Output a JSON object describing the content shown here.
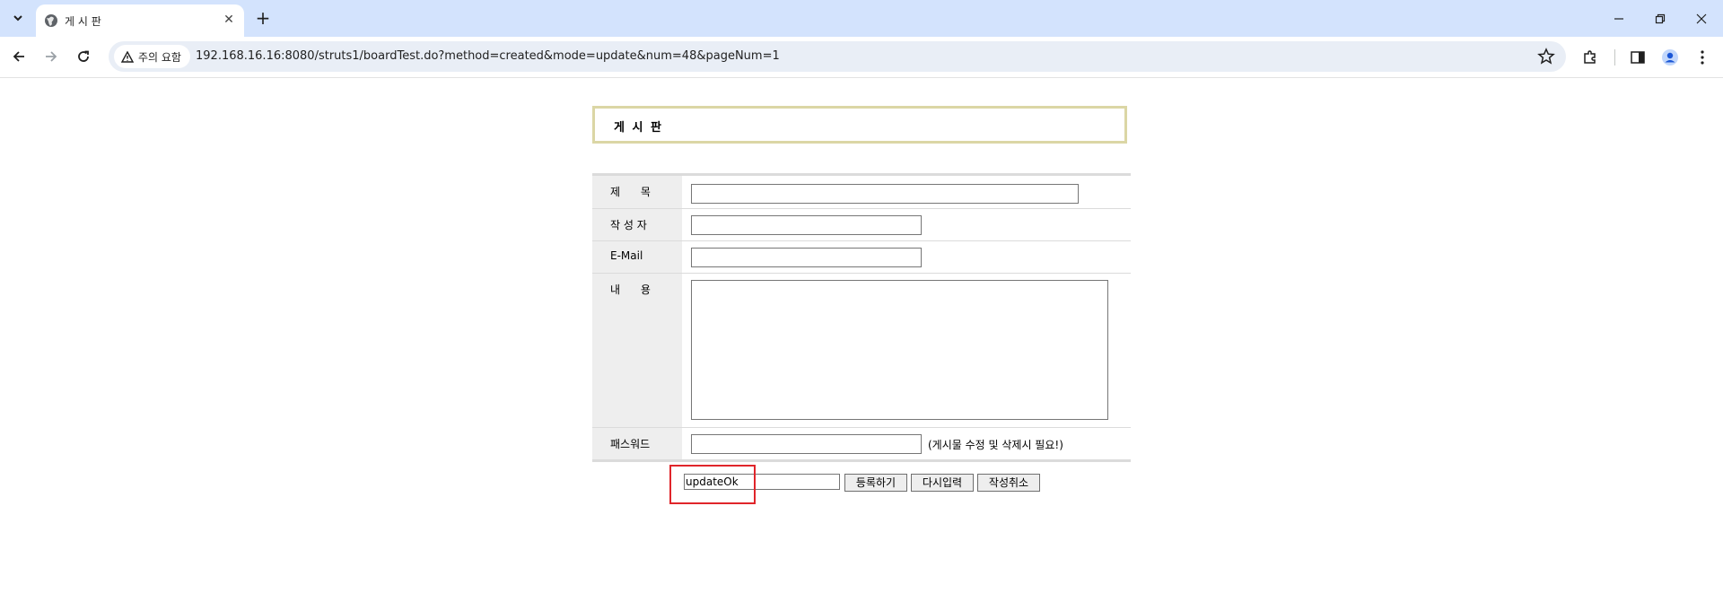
{
  "browser": {
    "tab_title": "게 시 판",
    "security_label": "주의 요함",
    "url": "192.168.16.16:8080/struts1/boardTest.do?method=created&mode=update&num=48&pageNum=1"
  },
  "page": {
    "board_title": "게 시 판",
    "form": {
      "subject_label": "제      목",
      "writer_label": "작 성 자",
      "email_label": "E-Mail",
      "content_label": "내      용",
      "password_label": "패스워드",
      "password_hint": "(게시물 수정 및 삭제시 필요!)",
      "subject_value": "",
      "writer_value": "",
      "email_value": "",
      "content_value": "",
      "password_value": ""
    },
    "actions": {
      "hidden_mode_value": "updateOk",
      "submit_label": "등록하기",
      "reset_label": "다시입력",
      "cancel_label": "작성취소"
    }
  },
  "colors": {
    "highlight": "#e0252a",
    "title_border": "#dbd6a5",
    "label_bg": "#eeeeee"
  }
}
